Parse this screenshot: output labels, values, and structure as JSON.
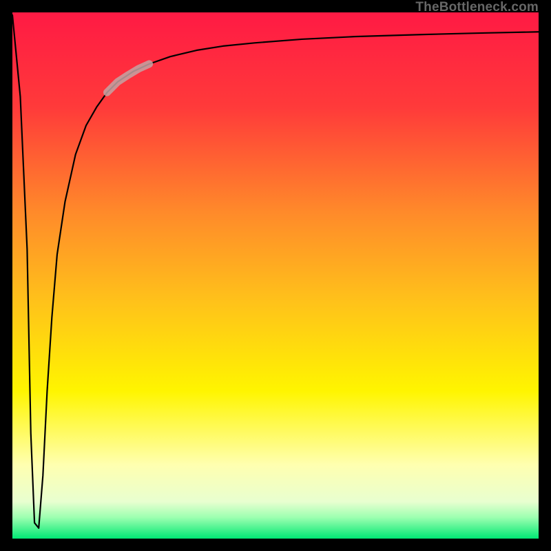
{
  "watermark": "TheBottleneck.com",
  "chart_data": {
    "type": "line",
    "title": "",
    "xlabel": "",
    "ylabel": "",
    "xlim": [
      0,
      100
    ],
    "ylim": [
      0,
      100
    ],
    "grid": false,
    "legend": false,
    "background_gradient_top_to_bottom": [
      "#FF1A44",
      "#FF5A33",
      "#FFB423",
      "#FFF500",
      "#FFFFA8",
      "#00E874"
    ],
    "series": [
      {
        "name": "bottleneck-curve",
        "color": "#000000",
        "stroke_width": 2.2,
        "x": [
          0.0,
          1.5,
          2.8,
          3.5,
          4.2,
          5.0,
          5.8,
          6.6,
          7.5,
          8.5,
          10.0,
          12.0,
          14.0,
          16.0,
          18.0,
          20.0,
          23.0,
          26.0,
          30.0,
          35.0,
          40.0,
          46.0,
          55.0,
          65.0,
          78.0,
          90.0,
          100.0
        ],
        "y": [
          99.5,
          84.0,
          55.0,
          20.0,
          3.0,
          2.0,
          12.0,
          28.0,
          42.0,
          54.0,
          64.0,
          73.0,
          78.5,
          82.0,
          84.8,
          86.8,
          88.8,
          90.2,
          91.6,
          92.8,
          93.6,
          94.2,
          94.9,
          95.4,
          95.8,
          96.1,
          96.3
        ]
      },
      {
        "name": "highlight-segment",
        "color": "#C4A3A3",
        "stroke_width": 11,
        "opacity": 0.85,
        "x": [
          18.0,
          20.0,
          22.0,
          24.0,
          26.0
        ],
        "y": [
          84.8,
          86.8,
          88.1,
          89.3,
          90.2
        ]
      }
    ]
  }
}
